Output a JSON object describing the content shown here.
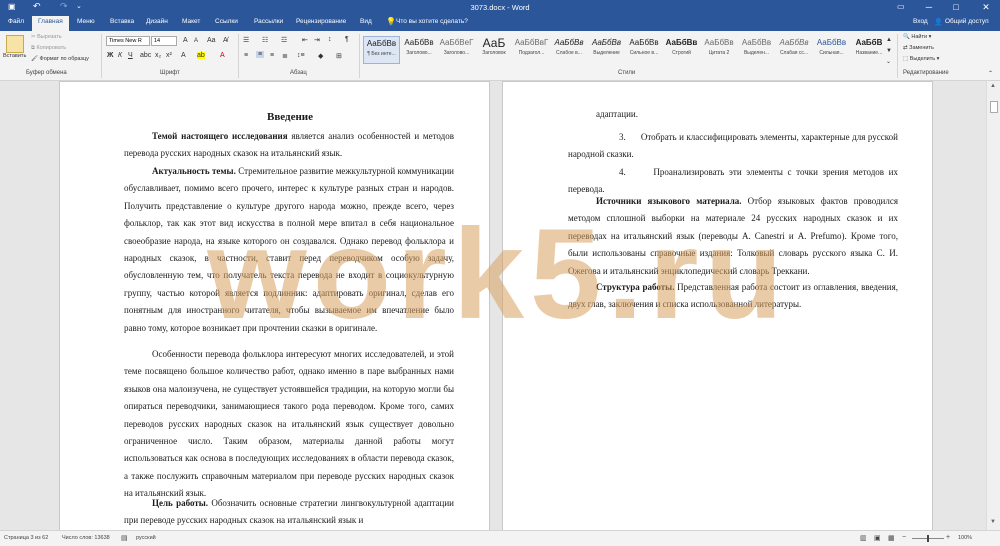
{
  "titlebar": {
    "title": "3073.docx - Word",
    "login": "Вход",
    "undo": "↶",
    "redo": "↷",
    "save": "💾"
  },
  "tabs": [
    "Файл",
    "Главная",
    "Меню",
    "Вставка",
    "Дизайн",
    "Макет",
    "Ссылки",
    "Рассылки",
    "Рецензирование",
    "Вид"
  ],
  "tell_me": "Что вы хотите сделать?",
  "share": "Общий доступ",
  "clipboard": {
    "paste": "Вставить",
    "cut": "Вырезать",
    "copy": "Копировать",
    "format": "Формат по образцу",
    "label": "Буфер обмена"
  },
  "font": {
    "name": "Times New R",
    "size": "14",
    "label": "Шрифт"
  },
  "paragraph_label": "Абзац",
  "styles": [
    {
      "preview": "АаБбВв",
      "name": "¶ Без инте..."
    },
    {
      "preview": "АаБбВв",
      "name": "Заголово..."
    },
    {
      "preview": "АаБбВеГ",
      "name": "Заголово..."
    },
    {
      "preview": "АаБ",
      "name": "Заголовок"
    },
    {
      "preview": "АаБбВвГ",
      "name": "Подзагол..."
    },
    {
      "preview": "АаБбВв",
      "name": "Слабое в..."
    },
    {
      "preview": "АаБбВв",
      "name": "Выделение"
    },
    {
      "preview": "АаБбВв",
      "name": "Сильное в..."
    },
    {
      "preview": "АаБбВв",
      "name": "Строгий"
    },
    {
      "preview": "АаБбВв",
      "name": "Цитата 2"
    },
    {
      "preview": "АаБбВв",
      "name": "Выделен..."
    },
    {
      "preview": "АаБбВв",
      "name": "Слабая сс..."
    },
    {
      "preview": "АаБбВв",
      "name": "Сильная..."
    },
    {
      "preview": "АаБбВ",
      "name": "Название..."
    }
  ],
  "styles_label": "Стили",
  "editing": {
    "find": "Найти",
    "replace": "Заменить",
    "select": "Выделить",
    "label": "Редактирование"
  },
  "page1": {
    "heading": "Введение",
    "p1_bold": "Темой настоящего исследования",
    "p1": " является анализ особенностей и методов перевода русских народных сказок на итальянский язык.",
    "p2_bold": "Актуальность темы.",
    "p2": " Стремительное развитие межкультурной коммуникации обуславливает, помимо всего прочего, интерес к культуре разных стран и народов. Получить представление о культуре другого народа можно, прежде всего, через фольклор, так как этот вид искусства в полной мере впитал в себя национальное своеобразие народа, на языке которого он создавался. Однако перевод фольклора и народных сказок, в частности, ставит перед переводчиком особую задачу, обусловленную тем, что получатель текста перевода не входит в социокультурную группу, частью которой является подлинник: адаптировать оригинал, сделав его понятным для иностранного читателя, чтобы вызываемое им впечатление было равно тому, которое возникает при прочтении сказки в оригинале.",
    "p3": "Особенности перевода фольклора интересуют многих исследователей, и этой теме посвящено большое количество работ, однако именно в паре выбранных нами языков она малоизучена, не существует устоявшейся традиции, на которую могли бы опираться переводчики, занимающиеся такого рода переводом. Кроме того, самих переводов русских народных сказок на итальянский язык существует довольно ограниченное число. Таким образом, материалы данной работы могут использоваться как основа в последующих исследованиях в области перевода сказок, а также послужить справочным материалом при переводе русских народных сказок на итальянский язык.",
    "p4_bold": "Цель работы.",
    "p4": " Обозначить основные стратегии лингвокультурной адаптации при переводе русских народных сказок на итальянский язык и"
  },
  "page2": {
    "p0": "адаптации.",
    "item3": "3.      Отобрать и классифицировать элементы, характерные для русской народной сказки.",
    "item4": "4.      Проанализировать эти элементы с точки зрения методов их перевода.",
    "s_bold": "Источники языкового материала.",
    "s": " Отбор языковых фактов проводился методом сплошной выборки на материале 24 русских народных сказок и их переводах на итальянский язык (переводы A. Canestri и A. Prefumo). Кроме того, были использованы справочные издания: Толковый словарь русского языка С. И. Ожегова и итальянский энциклопедический словарь Треккани.",
    "st_bold": "Структура работы.",
    "st": " Представленная работа состоит из оглавления, введения, двух глав, заключения и списка использованной литературы."
  },
  "watermark": "work5.ru",
  "status": {
    "page": "Страница 3 из 62",
    "words": "Число слов: 13638",
    "lang": "русский",
    "zoom": "100%"
  }
}
